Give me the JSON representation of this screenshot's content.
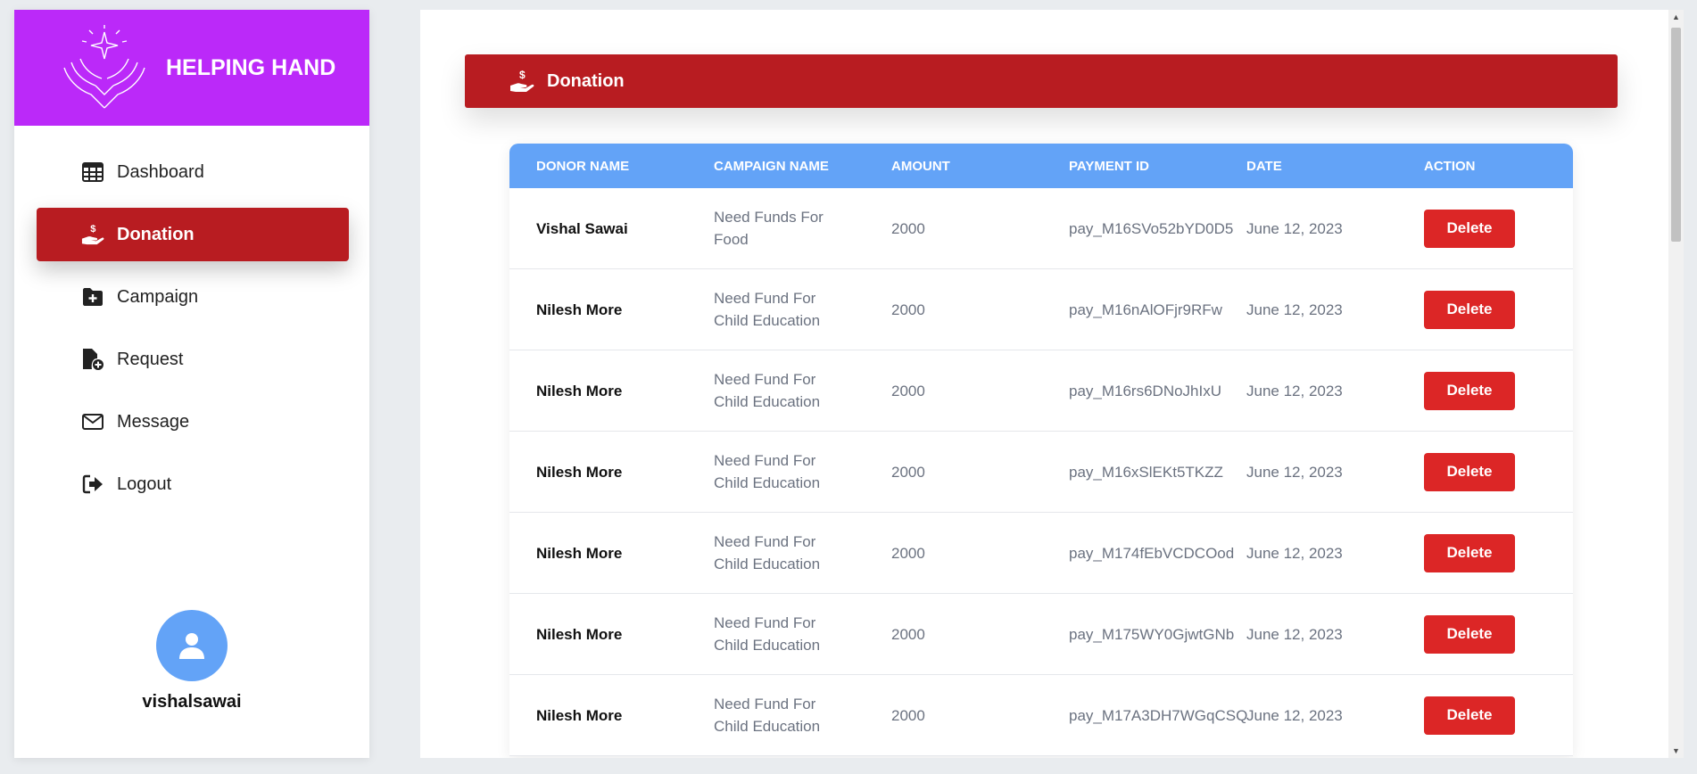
{
  "brand": {
    "name": "HELPING HAND",
    "logo": "hands-sparkle-logo"
  },
  "nav": [
    {
      "key": "dashboard",
      "label": "Dashboard",
      "icon": "table-icon",
      "active": false
    },
    {
      "key": "donation",
      "label": "Donation",
      "icon": "hand-dollar-icon",
      "active": true
    },
    {
      "key": "campaign",
      "label": "Campaign",
      "icon": "folder-plus-icon",
      "active": false
    },
    {
      "key": "request",
      "label": "Request",
      "icon": "file-plus-icon",
      "active": false
    },
    {
      "key": "message",
      "label": "Message",
      "icon": "envelope-icon",
      "active": false
    },
    {
      "key": "logout",
      "label": "Logout",
      "icon": "logout-icon",
      "active": false
    }
  ],
  "profile": {
    "username": "vishalsawai",
    "avatar_icon": "user-icon"
  },
  "header": {
    "title": "Donation",
    "icon": "hand-dollar-icon"
  },
  "table": {
    "columns": [
      "DONOR NAME",
      "CAMPAIGN NAME",
      "AMOUNT",
      "PAYMENT ID",
      "DATE",
      "ACTION"
    ],
    "rows": [
      {
        "donor": "Vishal Sawai",
        "campaign": "Need Funds For Food",
        "amount": "2000",
        "payment_id": "pay_M16SVo52bYD0D5",
        "date": "June 12, 2023",
        "action": "Delete"
      },
      {
        "donor": "Nilesh More",
        "campaign": "Need Fund For Child Education",
        "amount": "2000",
        "payment_id": "pay_M16nAlOFjr9RFw",
        "date": "June 12, 2023",
        "action": "Delete"
      },
      {
        "donor": "Nilesh More",
        "campaign": "Need Fund For Child Education",
        "amount": "2000",
        "payment_id": "pay_M16rs6DNoJhIxU",
        "date": "June 12, 2023",
        "action": "Delete"
      },
      {
        "donor": "Nilesh More",
        "campaign": "Need Fund For Child Education",
        "amount": "2000",
        "payment_id": "pay_M16xSlEKt5TKZZ",
        "date": "June 12, 2023",
        "action": "Delete"
      },
      {
        "donor": "Nilesh More",
        "campaign": "Need Fund For Child Education",
        "amount": "2000",
        "payment_id": "pay_M174fEbVCDCOod",
        "date": "June 12, 2023",
        "action": "Delete"
      },
      {
        "donor": "Nilesh More",
        "campaign": "Need Fund For Child Education",
        "amount": "2000",
        "payment_id": "pay_M175WY0GjwtGNb",
        "date": "June 12, 2023",
        "action": "Delete"
      },
      {
        "donor": "Nilesh More",
        "campaign": "Need Fund For Child Education",
        "amount": "2000",
        "payment_id": "pay_M17A3DH7WGqCSQ",
        "date": "June 12, 2023",
        "action": "Delete"
      }
    ]
  },
  "colors": {
    "brand": "#bb29f9",
    "accent": "#b81c21",
    "table_header": "#63a3f7",
    "delete": "#dc2626"
  }
}
